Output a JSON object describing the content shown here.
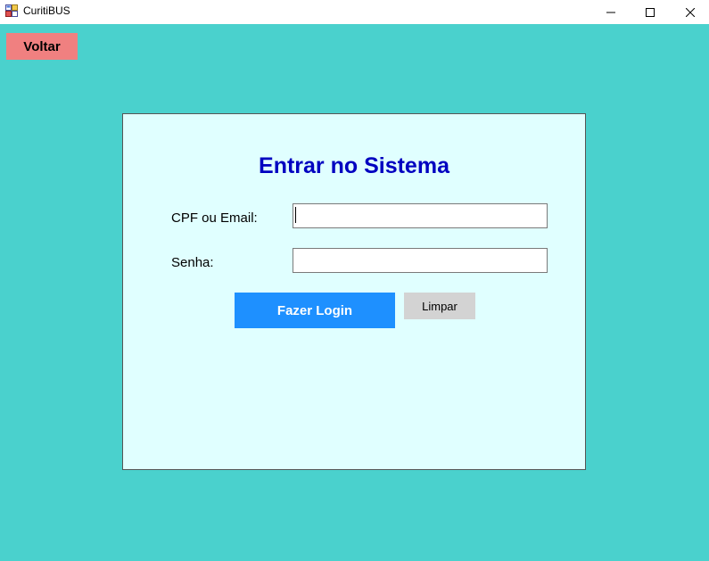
{
  "window": {
    "title": "CuritiBUS",
    "app_icon": "app-icon",
    "controls": {
      "minimize_icon": "minimize-icon",
      "maximize_icon": "maximize-icon",
      "close_icon": "close-icon"
    },
    "background_color": "#4ad1cd"
  },
  "toolbar": {
    "back_label": "Voltar",
    "back_color": "#f08080"
  },
  "login_form": {
    "title": "Entrar no Sistema",
    "title_color": "#0000c0",
    "panel_color": "#e0ffff",
    "cpf_label": "CPF ou Email:",
    "cpf_value": "",
    "password_label": "Senha:",
    "password_value": "",
    "login_button_label": "Fazer Login",
    "login_button_color": "#1e90ff",
    "clear_button_label": "Limpar",
    "clear_button_color": "#d3d3d3"
  }
}
